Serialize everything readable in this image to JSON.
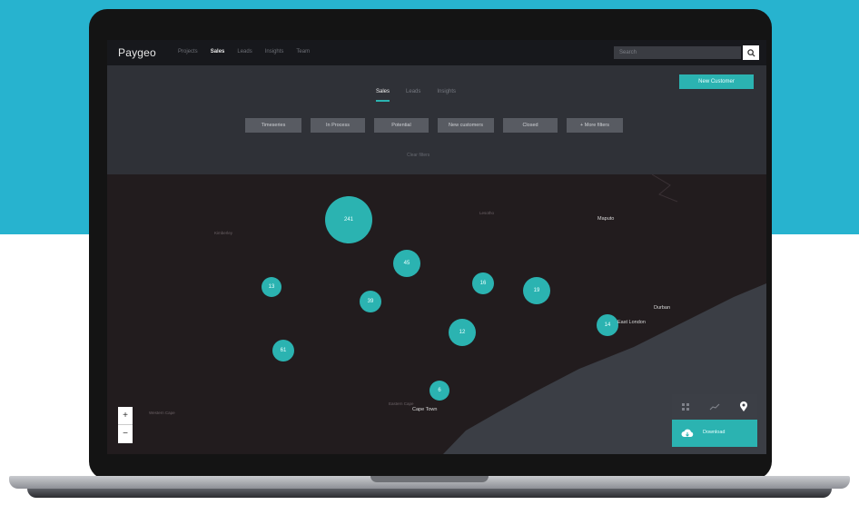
{
  "colors": {
    "band": "#27b3cf",
    "accent": "#2bb3b1",
    "map_land": "#221c1e",
    "map_sea": "#3b3e45"
  },
  "app": {
    "logo": "Paygeo"
  },
  "nav": [
    "Projects",
    "Sales",
    "Leads",
    "Insights",
    "Team"
  ],
  "search": {
    "placeholder": "Search",
    "icon": "search-icon"
  },
  "filter": {
    "new_button": "New Customer",
    "tabs": [
      "Sales",
      "Leads",
      "Insights"
    ],
    "chips": [
      "Timeseries",
      "In Process",
      "Potential",
      "New customers",
      "Closed",
      "+ More filters"
    ],
    "hint": "Clear filters"
  },
  "map": {
    "clusters": [
      "241",
      "45",
      "13",
      "39",
      "16",
      "19",
      "12",
      "61",
      "14"
    ],
    "places": [
      "Durban",
      "East London",
      "Maputo",
      "Cape Town"
    ],
    "zoom_in": "+",
    "zoom_out": "−"
  },
  "view_panel": {
    "icons": [
      "grid-icon",
      "chart-icon",
      "map-pin-icon"
    ],
    "download_label": "Download",
    "download_icon": "cloud-download-icon"
  }
}
